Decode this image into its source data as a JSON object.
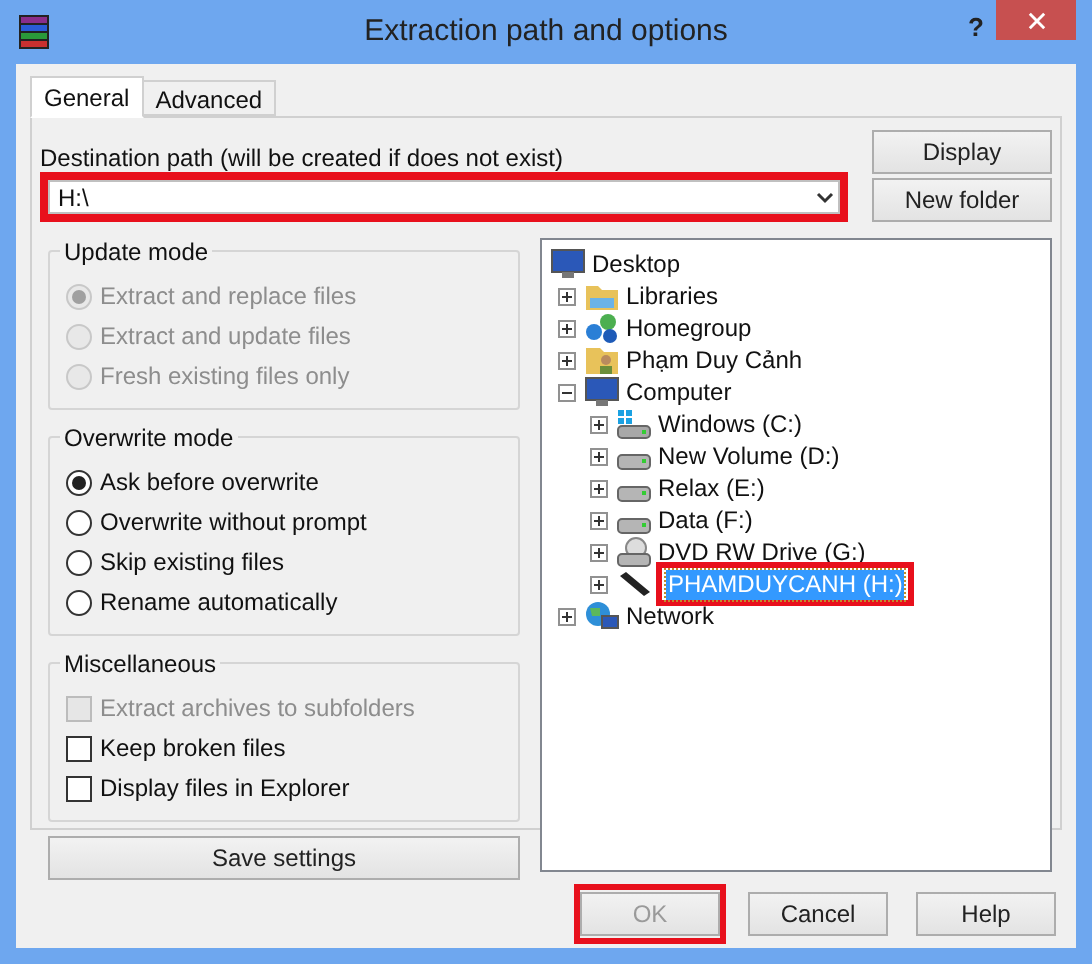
{
  "window": {
    "title": "Extraction path and options",
    "help_button": "?"
  },
  "tabs": [
    {
      "label": "General",
      "selected": true
    },
    {
      "label": "Advanced",
      "selected": false
    }
  ],
  "destination": {
    "label": "Destination path (will be created if does not exist)",
    "value": "H:\\",
    "highlighted": true
  },
  "side_buttons": [
    "Display",
    "New folder"
  ],
  "update_mode": {
    "title": "Update mode",
    "disabled": true,
    "options": [
      {
        "label": "Extract and replace files",
        "selected": true
      },
      {
        "label": "Extract and update files",
        "selected": false
      },
      {
        "label": "Fresh existing files only",
        "selected": false
      }
    ]
  },
  "overwrite_mode": {
    "title": "Overwrite mode",
    "disabled": false,
    "options": [
      {
        "label": "Ask before overwrite",
        "selected": true
      },
      {
        "label": "Overwrite without prompt",
        "selected": false
      },
      {
        "label": "Skip existing files",
        "selected": false
      },
      {
        "label": "Rename automatically",
        "selected": false
      }
    ]
  },
  "miscellaneous": {
    "title": "Miscellaneous",
    "options": [
      {
        "label": "Extract archives to subfolders",
        "checked": false,
        "disabled": true
      },
      {
        "label": "Keep broken files",
        "checked": false,
        "disabled": false
      },
      {
        "label": "Display files in Explorer",
        "checked": false,
        "disabled": false
      }
    ]
  },
  "save_button": "Save settings",
  "tree": [
    {
      "label": "Desktop",
      "kind": "desktop",
      "selected": false,
      "children": [
        {
          "label": "Libraries",
          "kind": "library",
          "expanded": false,
          "selected": false
        },
        {
          "label": "Homegroup",
          "kind": "homegroup",
          "expanded": false,
          "selected": false
        },
        {
          "label": "Phạm Duy Cảnh",
          "kind": "user",
          "expanded": false,
          "selected": false
        },
        {
          "label": "Computer",
          "kind": "computer",
          "expanded": true,
          "selected": false,
          "children": [
            {
              "label": "Windows (C:)",
              "kind": "system-drive",
              "expanded": false,
              "selected": false
            },
            {
              "label": "New Volume (D:)",
              "kind": "drive",
              "expanded": false,
              "selected": false
            },
            {
              "label": "Relax (E:)",
              "kind": "drive",
              "expanded": false,
              "selected": false
            },
            {
              "label": "Data (F:)",
              "kind": "drive",
              "expanded": false,
              "selected": false
            },
            {
              "label": "DVD RW Drive (G:)",
              "kind": "dvd",
              "expanded": false,
              "selected": false
            },
            {
              "label": "PHAMDUYCANH (H:)",
              "kind": "usb",
              "expanded": false,
              "selected": true,
              "highlighted": true
            }
          ]
        },
        {
          "label": "Network",
          "kind": "network",
          "expanded": false,
          "selected": false
        }
      ]
    }
  ],
  "footer_buttons": [
    {
      "label": "OK",
      "disabled": true,
      "highlighted": true
    },
    {
      "label": "Cancel",
      "disabled": false,
      "highlighted": false
    },
    {
      "label": "Help",
      "disabled": false,
      "highlighted": false
    }
  ]
}
